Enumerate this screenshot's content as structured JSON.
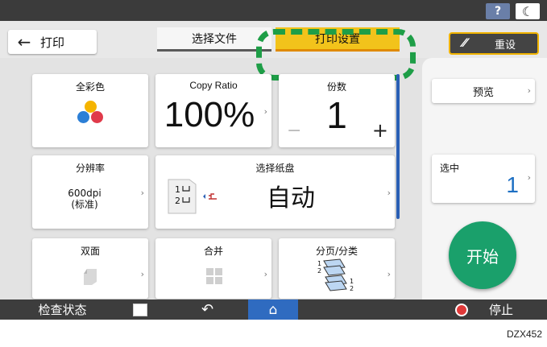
{
  "topbar": {
    "help_label": "?",
    "moon_label": "☾"
  },
  "header": {
    "back_arrow": "←",
    "title": "打印",
    "tabs": [
      {
        "label": "选择文件"
      },
      {
        "label": "打印设置"
      }
    ],
    "reset_label": "重设",
    "reset_icon": "⁄⁄"
  },
  "tiles": {
    "color": {
      "title": "全彩色",
      "dots": [
        "#f5b400",
        "#2c7fd6",
        "#e03a4a"
      ]
    },
    "ratio": {
      "title": "Copy Ratio",
      "value": "100%"
    },
    "copies": {
      "title": "份数",
      "value": "1",
      "minus": "−",
      "plus": "+"
    },
    "resolution": {
      "title": "分辨率",
      "value_line1": "600dpi",
      "value_line2": "(标准)"
    },
    "tray": {
      "title": "选择纸盘",
      "value": "自动",
      "tray1": "1",
      "tray2": "2"
    },
    "duplex": {
      "title": "双面"
    },
    "combine": {
      "title": "合并"
    },
    "sort": {
      "title": "分页/分类"
    }
  },
  "chevron": "›",
  "right_panel": {
    "preview_label": "预览",
    "selected_label": "选中",
    "selected_value": "1",
    "start_label": "开始"
  },
  "bottombar": {
    "check_status": "检查状态",
    "return_icon": "↶",
    "home_icon": "⌂",
    "stop_label": "停止"
  },
  "caption": "DZX452",
  "colors": {
    "accent_tab": "#f2c31b",
    "highlight": "#1e9e47",
    "start": "#1aa06b",
    "home": "#2f6bc0"
  }
}
